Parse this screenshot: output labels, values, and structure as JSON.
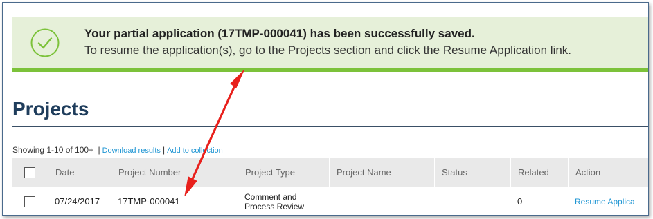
{
  "banner": {
    "title": "Your partial application (17TMP-000041) has been successfully saved.",
    "message": "To resume the application(s), go to the Projects section and click the Resume Application link.",
    "icon": "check-circle-icon",
    "accent_color": "#7cc23a",
    "background_color": "#e6f0d9"
  },
  "page": {
    "title": "Projects"
  },
  "results": {
    "showing": "Showing 1-10 of 100+",
    "separator": "|",
    "download_link": "Download results",
    "collection_link": "Add to collection"
  },
  "table": {
    "headers": [
      "Date",
      "Project Number",
      "Project Type",
      "Project Name",
      "Status",
      "Related",
      "Action"
    ],
    "rows": [
      {
        "date": "07/24/2017",
        "project_number": "17TMP-000041",
        "project_type_line1": "Comment and",
        "project_type_line2": "Process Review",
        "project_name": "",
        "status": "",
        "related": "0",
        "action": "Resume Applica"
      }
    ]
  },
  "annotation": {
    "color": "#e8201c"
  }
}
